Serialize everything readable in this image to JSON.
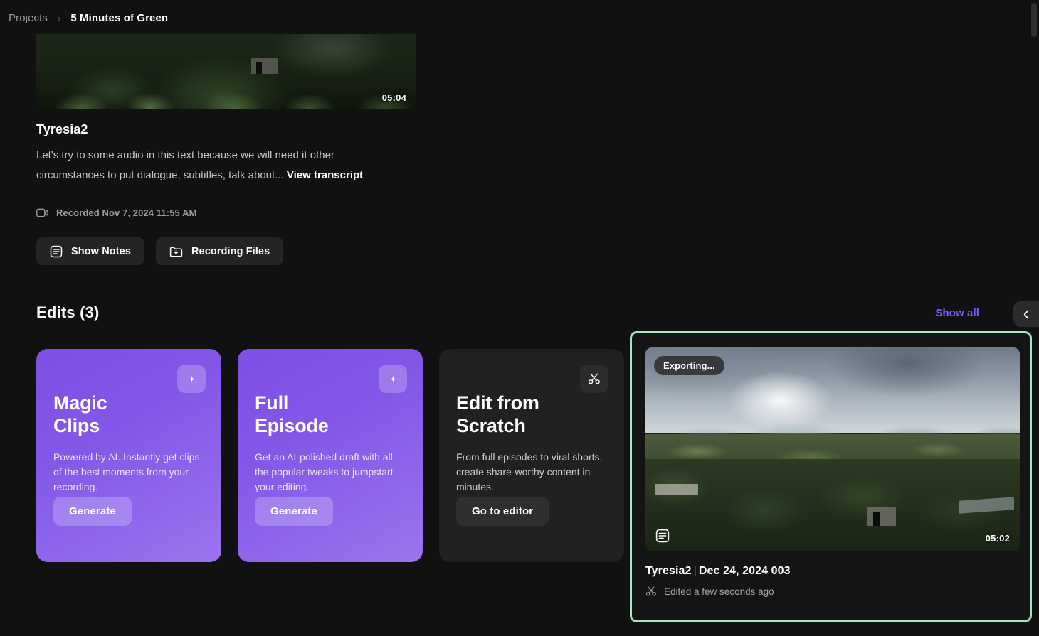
{
  "breadcrumb": {
    "root_label": "Projects",
    "separator": "›",
    "current_label": "5 Minutes of Green"
  },
  "recording": {
    "duration": "05:04",
    "title": "Tyresia2",
    "description": "Let's try to some audio in this text because we will need it other circumstances to put dialogue, subtitles, talk about...",
    "transcript_link": "View transcript",
    "recorded_label": "Recorded Nov 7, 2024 11:55 AM",
    "recorded_icon": "video-camera-icon",
    "actions": [
      {
        "label": "Show Notes",
        "icon": "notes-icon"
      },
      {
        "label": "Recording Files",
        "icon": "folder-download-icon"
      }
    ]
  },
  "edits": {
    "heading": "Edits (3)",
    "show_all_label": "Show all",
    "show_all_color": "#7c5cff",
    "prev_icon": "chevron-left-icon",
    "cards": [
      {
        "title": "Magic\nClips",
        "body": "Powered by AI. Instantly get clips of the best moments from your recording.",
        "cta": "Generate",
        "badge_icon": "sparkle-icon",
        "accent": "#8358e8"
      },
      {
        "title": "Full\nEpisode",
        "body": "Get an AI-polished draft with all the popular tweaks to jumpstart your editing.",
        "cta": "Generate",
        "badge_icon": "sparkle-icon",
        "accent": "#8358e8"
      },
      {
        "title": "Edit from\nScratch",
        "body": "From full episodes to viral shorts, create share-worthy content in minutes.",
        "cta": "Go to editor",
        "badge_icon": "scissors-icon",
        "accent": "#212121"
      }
    ]
  },
  "export_card": {
    "status_badge": "Exporting...",
    "duration": "05:02",
    "notes_icon": "notes-icon",
    "name": "Tyresia2",
    "name_separator": "|",
    "name_suffix": "Dec 24, 2024 003",
    "edited_label": "Edited a few seconds ago",
    "edited_icon": "scissors-icon",
    "highlight_color": "#a6e4bf"
  }
}
